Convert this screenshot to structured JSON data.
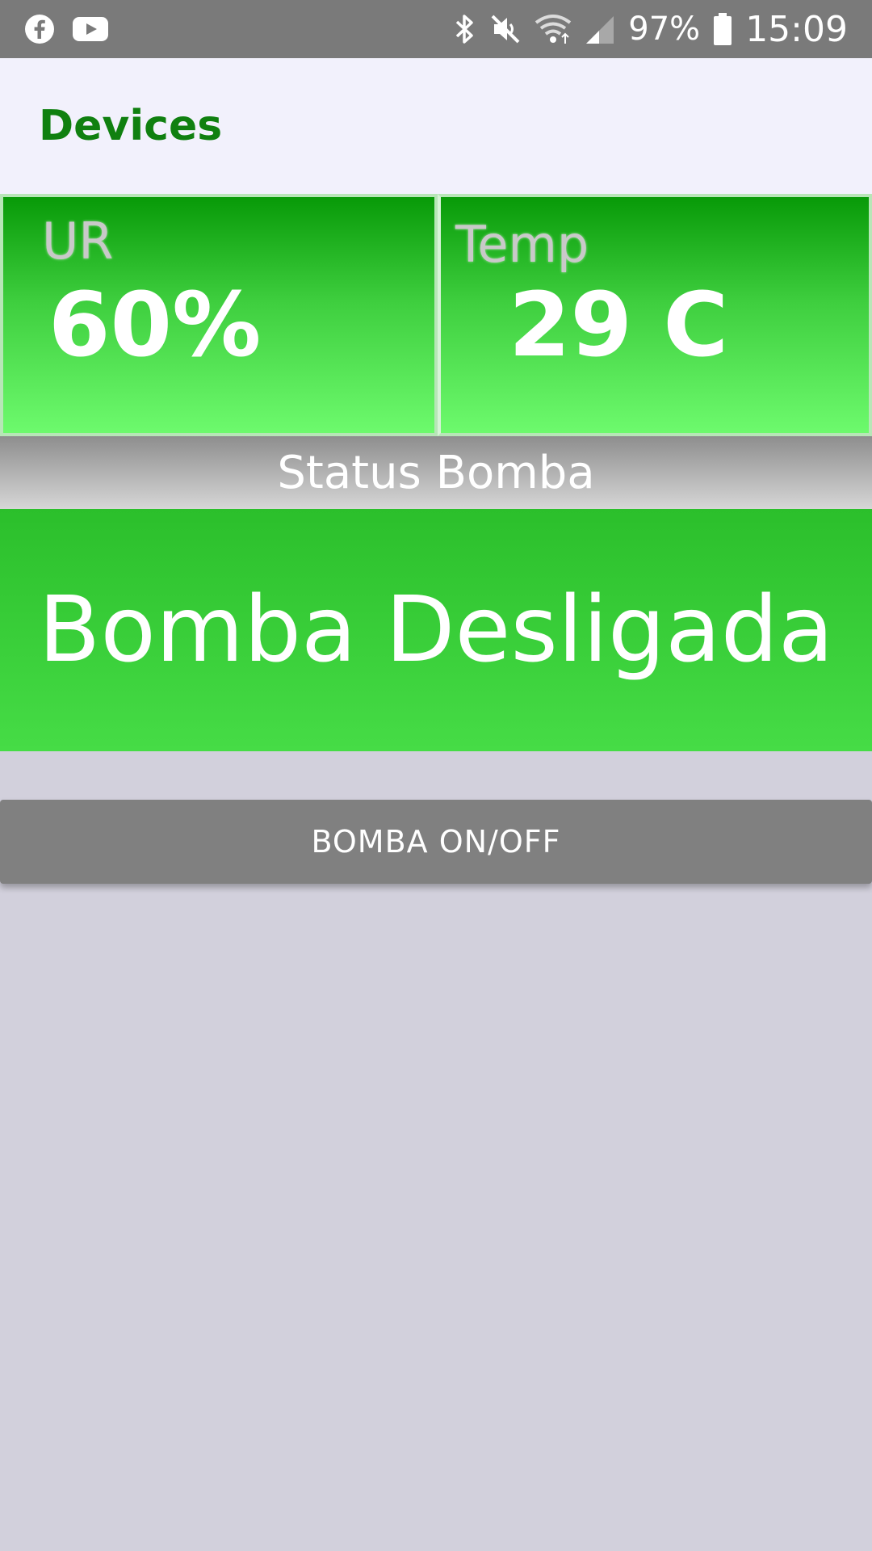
{
  "status_bar": {
    "battery_level": "97%",
    "time": "15:09",
    "left_icons": [
      "facebook-icon",
      "youtube-icon"
    ],
    "right_icons": [
      "bluetooth-icon",
      "mute-icon",
      "wifi-icon",
      "signal-icon",
      "battery-icon"
    ]
  },
  "app_bar": {
    "title": "Devices"
  },
  "sensors": {
    "humidity": {
      "label": "UR",
      "value": "60%"
    },
    "temperature": {
      "label": "Temp",
      "value": "29 C"
    }
  },
  "pump": {
    "status_header": "Status Bomba",
    "status_text": "Bomba Desligada",
    "toggle_label": "BOMBA ON/OFF"
  },
  "colors": {
    "title_green": "#108010",
    "sensor_green_top": "#089a08",
    "sensor_green_bottom": "#6dfa6d",
    "status_green": "#2bbf2b",
    "button_gray": "#808080",
    "background": "#d2d0dc"
  }
}
